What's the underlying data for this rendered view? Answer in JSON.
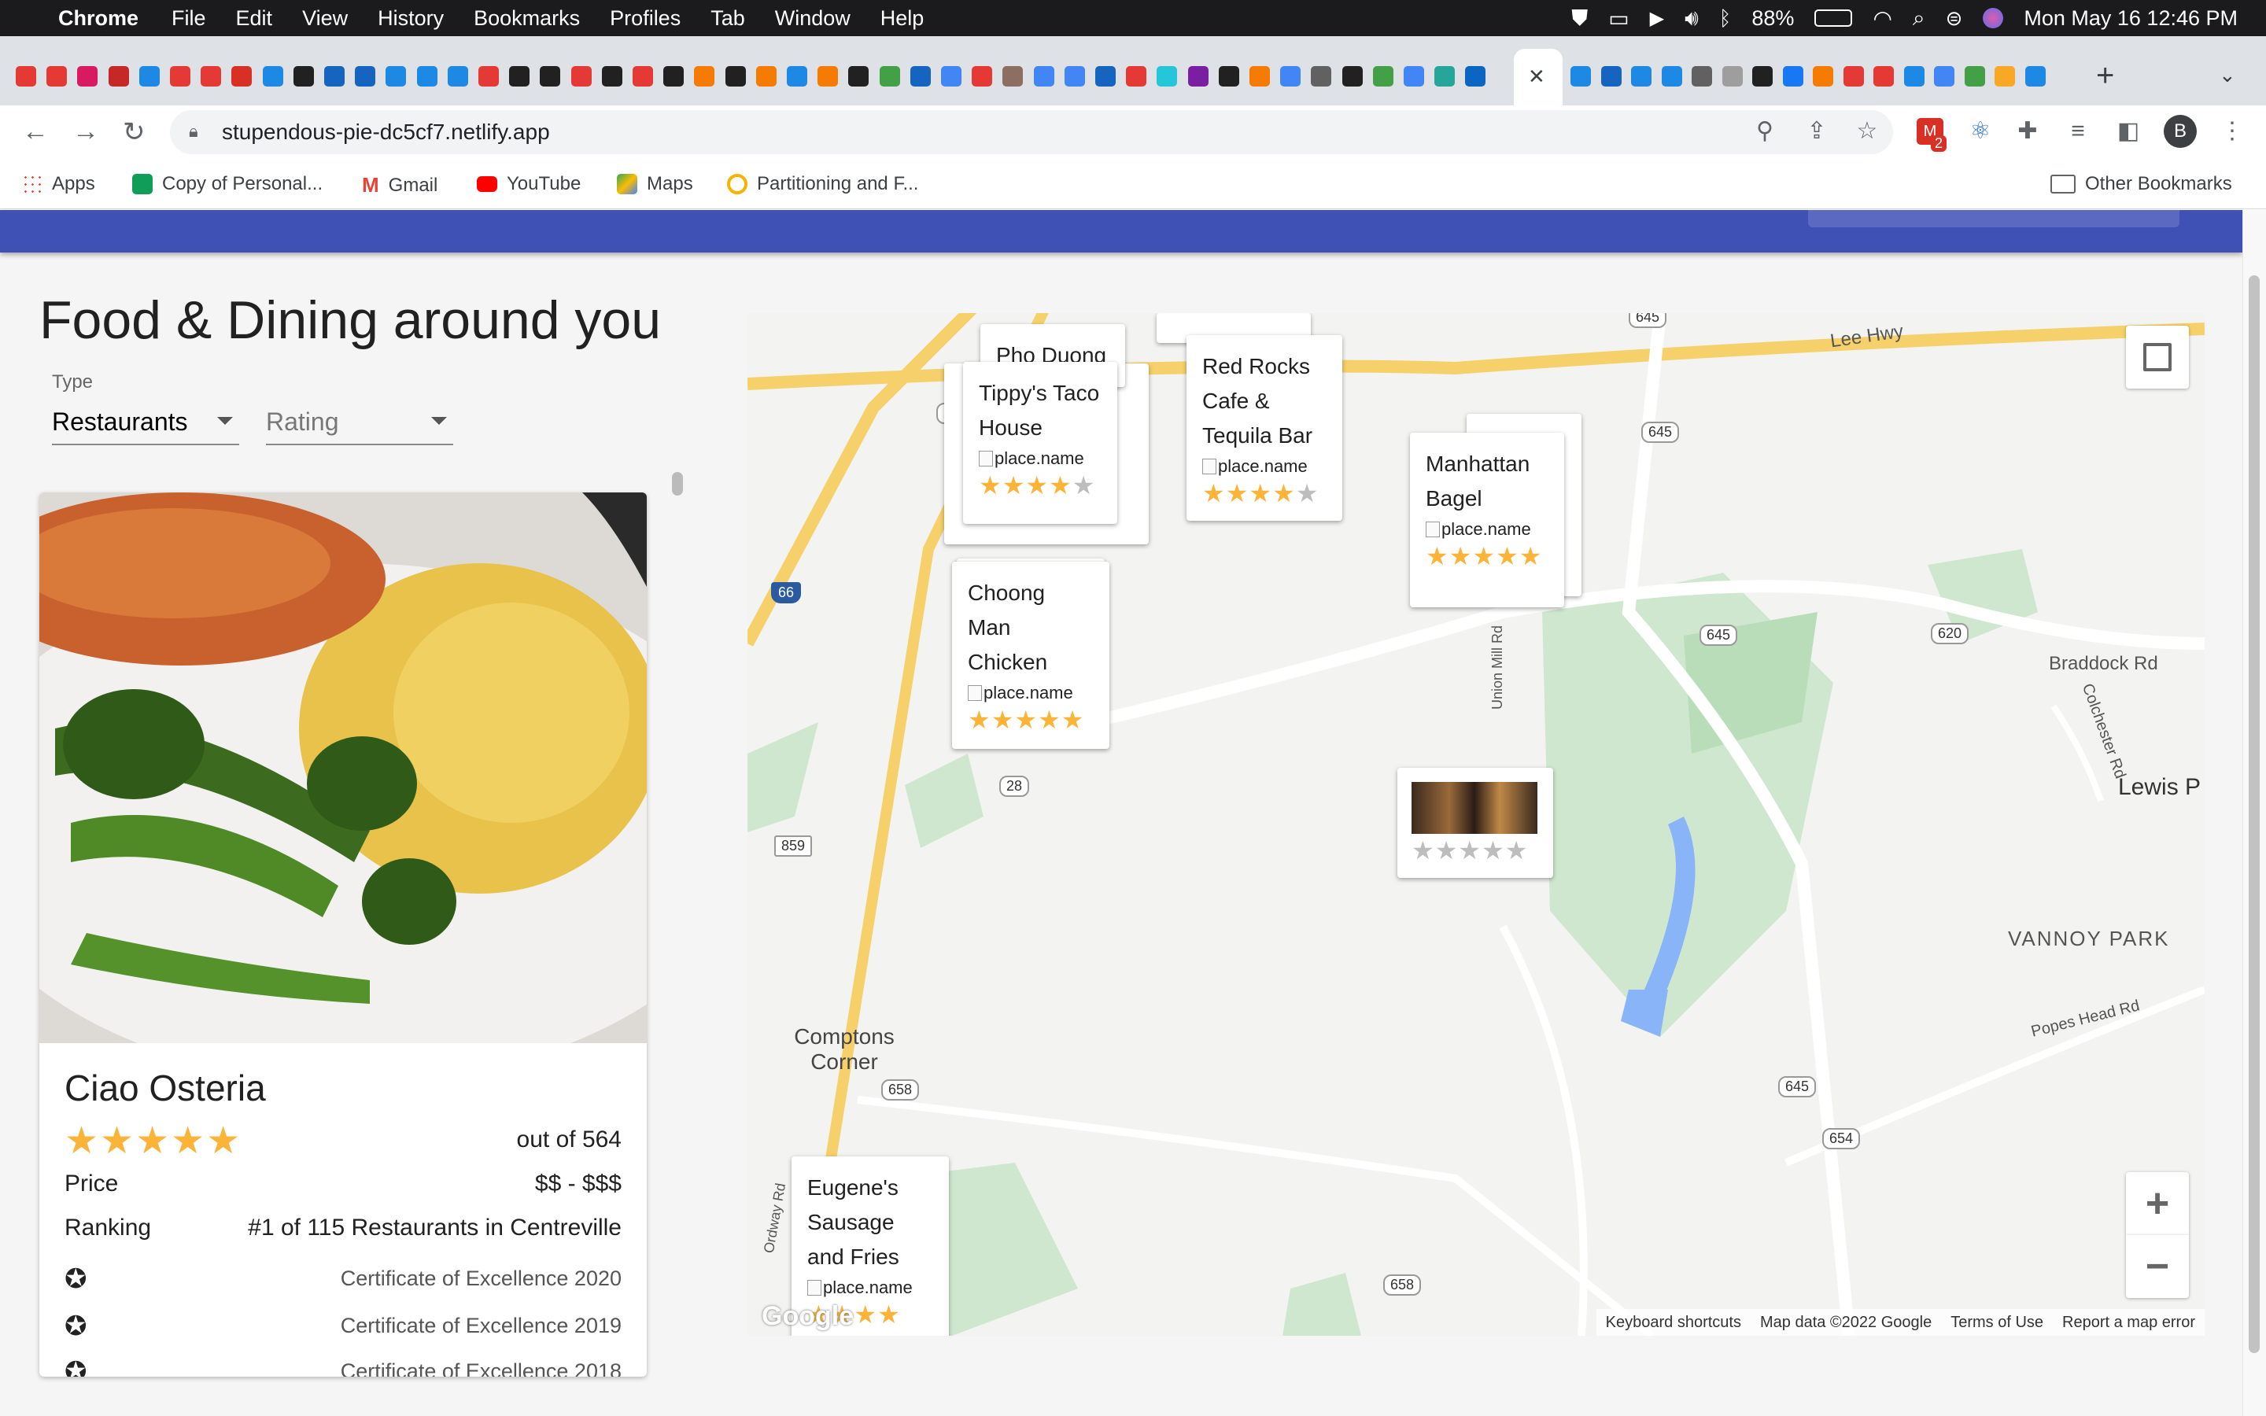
{
  "menubar": {
    "app": "Chrome",
    "items": [
      "File",
      "Edit",
      "View",
      "History",
      "Bookmarks",
      "Profiles",
      "Tab",
      "Window",
      "Help"
    ],
    "battery": "88%",
    "clock": "Mon May 16  12:46 PM"
  },
  "browser": {
    "url": "stupendous-pie-dc5cf7.netlify.app",
    "profile_initial": "B",
    "extension_badge": "2",
    "new_tab": "+",
    "close_tab": "✕"
  },
  "bookmarks": {
    "items": [
      "Apps",
      "Copy of Personal...",
      "Gmail",
      "YouTube",
      "Maps",
      "Partitioning and F..."
    ],
    "other": "Other Bookmarks"
  },
  "page": {
    "heading": "Food & Dining around you",
    "type_label": "Type",
    "type_value": "Restaurants",
    "rating_placeholder": "Rating"
  },
  "card": {
    "name": "Ciao Osteria",
    "stars": "★★★★★",
    "reviews": "out of 564",
    "price_label": "Price",
    "price_value": "$$ - $$$",
    "ranking_label": "Ranking",
    "ranking_value": "#1 of 115 Restaurants in Centreville",
    "awards": [
      "Certificate of Excellence 2020",
      "Certificate of Excellence 2019",
      "Certificate of Excellence 2018"
    ]
  },
  "map": {
    "pins": [
      {
        "name": "Pho Duong",
        "img_alt": "",
        "stars_filled": "",
        "stars_empty": ""
      },
      {
        "name": "Tippy's Taco House",
        "img_alt": "place.name",
        "stars_filled": "★★★★",
        "stars_empty": "★"
      },
      {
        "name": "Red Rocks Cafe & Tequila Bar",
        "img_alt": "place.name",
        "stars_filled": "★★★★",
        "stars_empty": "★"
      },
      {
        "name": "Manhattan Bagel",
        "img_alt": "place.name",
        "stars_filled": "★★★★★",
        "stars_empty": ""
      },
      {
        "name": "Choong Man Chicken",
        "img_alt": "place.name",
        "stars_filled": "★★★★★",
        "stars_empty": ""
      },
      {
        "name": "",
        "img_alt": "",
        "stars_filled": "",
        "stars_empty": "★★★★★"
      },
      {
        "name": "Eugene's Sausage and Fries",
        "img_alt": "place.name",
        "stars_filled": "★★★★",
        "stars_empty": ""
      }
    ],
    "labels": {
      "lee_hwy": "Lee Hwy",
      "braddock": "Braddock Rd",
      "colchester": "Colchester Rd",
      "lewis": "Lewis P",
      "vannoy": "VANNOY PARK",
      "popes": "Popes Head Rd",
      "comptons": "Comptons Corner",
      "union_mill": "Union Mill Rd",
      "ordway": "Ordway Rd"
    },
    "shields": [
      "645",
      "645",
      "645",
      "620",
      "645",
      "654",
      "658",
      "658",
      "28",
      "859",
      "29",
      "66"
    ],
    "zoom_in": "+",
    "zoom_out": "−",
    "google": "Google",
    "attribution": [
      "Keyboard shortcuts",
      "Map data ©2022 Google",
      "Terms of Use",
      "Report a map error"
    ]
  }
}
